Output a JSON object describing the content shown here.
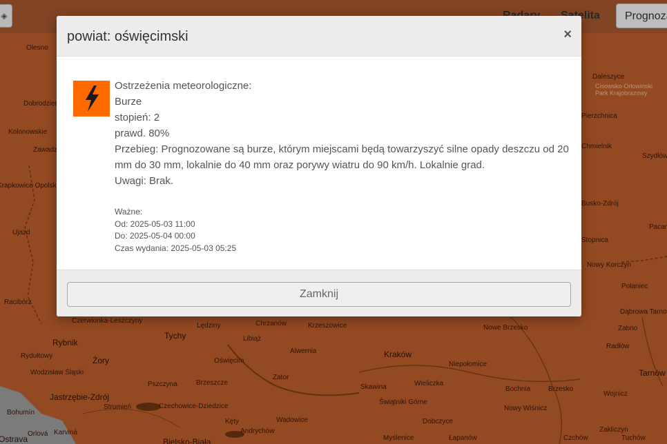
{
  "toolbar": {
    "locate_icon": "crosshair-icon",
    "tabs": [
      "Radary",
      "Satelita",
      "Prognoza"
    ]
  },
  "map": {
    "towns": [
      "Olesno",
      "Dobrodzień",
      "Kolonowskie",
      "Zawadzkie",
      "Krapkowice Opolskie",
      "Ujazd",
      "Racibórz",
      "Czerwionka-Leszczyny",
      "Rybnik",
      "Rydułtowy",
      "Wodzisław Śląski",
      "Jastrzębie-Zdrój",
      "Bohumín",
      "Orlová",
      "Karviná",
      "Ostrava",
      "Żory",
      "Tychy",
      "Lędziny",
      "Chrzanów",
      "Krzeszowice",
      "Libiąż",
      "Alwernia",
      "Oświęcim",
      "Pszczyna",
      "Brzeszcze",
      "Zator",
      "Kraków",
      "Niepołomice",
      "Skawina",
      "Wieliczka",
      "Bochnia",
      "Brzesko",
      "Nowe Brzesko",
      "Świątniki Górne",
      "Dobczyce",
      "Nowy Wiśnicz",
      "Czechowice-Dziedzice",
      "Strumień",
      "Kęty",
      "Andrychów",
      "Wadowice",
      "Myślenice",
      "Bielsko-Biała",
      "Łapanów",
      "Tarnów",
      "Wojnicz",
      "Zakliczyn",
      "Radłów",
      "Zabno",
      "Dąbrowa Tarnowska",
      "Nowy Korczyn",
      "Połaniec",
      "Stopnica",
      "Pacanów",
      "Daleszyce",
      "Chmielnik",
      "Szydłów",
      "Pierzchnica",
      "Busko-Zdrój",
      "Czchów",
      "Tuchów"
    ],
    "labels_light": [
      "Cisowsko-Orłowiński Park Krajobrazowy"
    ]
  },
  "modal": {
    "title": "powiat: oświęcimski",
    "close_label": "×",
    "icon": "lightning-warning-icon",
    "icon_color": "#ff6a00",
    "lines": [
      "Ostrzeżenia meteorologiczne:",
      "Burze",
      "stopień: 2",
      "prawd. 80%",
      "Przebieg: Prognozowane są burze, którym miejscami będą towarzyszyć silne opady deszczu od 20 mm do 30 mm, lokalnie do 40 mm oraz porywy wiatru do 90 km/h. Lokalnie grad.",
      "Uwagi: Brak."
    ],
    "meta": [
      "Ważne:",
      "Od: 2025-05-03 11:00",
      "Do: 2025-05-04 00:00",
      "Czas wydania: 2025-05-03 05:25"
    ],
    "dismiss_label": "Zamknij"
  }
}
